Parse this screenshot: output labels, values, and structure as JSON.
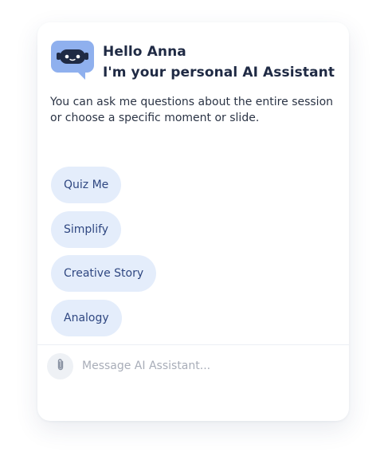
{
  "assistant": {
    "greeting_line1": "Hello Anna",
    "greeting_line2": "I'm your personal AI Assistant",
    "intro": "You can ask me questions about the entire session or choose a specific moment or slide.",
    "avatar_icon": "robot-icon",
    "avatar_color": "#8fb0ee"
  },
  "suggestions": [
    {
      "label": "Quiz Me"
    },
    {
      "label": "Simplify"
    },
    {
      "label": "Creative Story"
    },
    {
      "label": "Analogy"
    }
  ],
  "composer": {
    "placeholder": "Message AI Assistant...",
    "value": "",
    "attach_icon": "paperclip-icon"
  },
  "colors": {
    "chip_bg": "#e4edfb",
    "chip_text": "#2f4781",
    "heading": "#1f2a44"
  }
}
